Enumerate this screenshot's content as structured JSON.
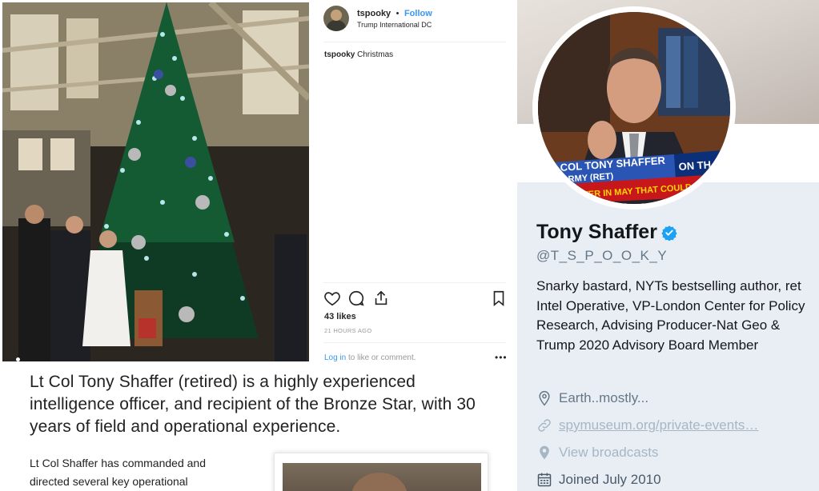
{
  "instagram": {
    "username": "tspooky",
    "separator": "•",
    "follow_label": "Follow",
    "location": "Trump International DC",
    "caption_user": "tspooky",
    "caption_text": "Christmas",
    "likes": "43 likes",
    "timestamp": "21 HOURS AGO",
    "login_link": "Log in",
    "login_rest": " to like or comment.",
    "more_label": "•••",
    "icons": [
      "heart-icon",
      "comment-icon",
      "share-icon",
      "bookmark-icon"
    ]
  },
  "article": {
    "lead": "Lt Col Tony Shaffer (retired) is a highly experienced intelligence officer, and recipient of the Bronze Star, with 30 years of field and operational experience.",
    "body": "Lt Col Shaffer has commanded and directed several key operational"
  },
  "twitter": {
    "name": "Tony Shaffer",
    "handle": "@T_S_P_O_O_K_Y",
    "bio": "Snarky bastard, NYTs bestselling author, ret Intel Operative, VP-London Center for Policy Research, Advising Producer-Nat Geo & Trump 2020 Advisory Board Member",
    "location": "Earth..mostly...",
    "website": "spymuseum.org/private-events…",
    "broadcasts": "View broadcasts",
    "joined": "Joined July 2010",
    "avatar_chyron_line1": "COL TONY SHAFFER",
    "avatar_chyron_line2": "ARMY (RET)",
    "avatar_ticker": "GHTER IN MAY THAT COULD R",
    "avatar_on_label": "ON TH",
    "verified_color": "#1da1f2"
  }
}
